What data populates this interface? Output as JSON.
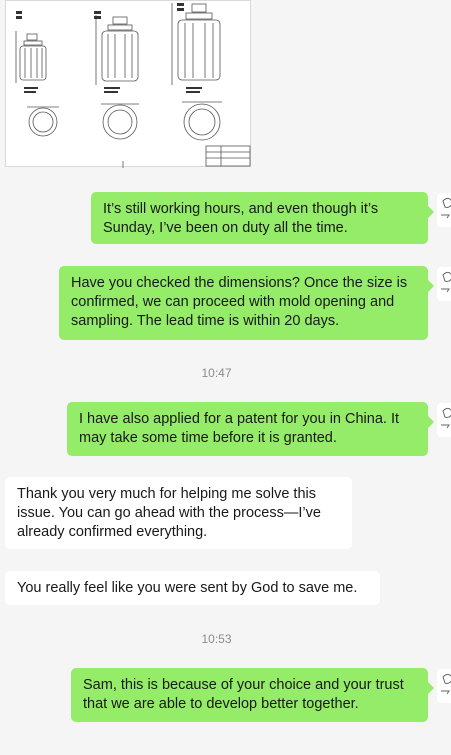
{
  "messages": [
    {
      "id": "m1",
      "side": "out",
      "text": "It’s still working hours, and even though it’s Sunday, I’ve been on duty all the time."
    },
    {
      "id": "m2",
      "side": "out",
      "text": "Have you checked the dimensions? Once the size is confirmed, we can proceed with mold opening and sampling. The lead time is within 20 days."
    },
    {
      "id": "m3",
      "side": "out",
      "text": "I have also applied for a patent for you in China. It may take some time before it is granted."
    },
    {
      "id": "m4",
      "side": "in",
      "text": "Thank you very much for helping me solve this issue. You can go ahead with the process—I’ve already confirmed everything."
    },
    {
      "id": "m5",
      "side": "in",
      "text": "You really feel like you were sent by God to save me."
    },
    {
      "id": "m6",
      "side": "out",
      "text": "Sam, this is because of your choice and your trust that we are able to develop better together."
    }
  ],
  "timestamps": [
    "10:47",
    "10:53"
  ],
  "colors": {
    "outgoing_bubble": "#95ec69",
    "incoming_bubble": "#ffffff",
    "background": "#f5f5f5",
    "timestamp": "#8c8c8c"
  },
  "icons": {
    "attachment": "technical-drawing-image",
    "avatar": "user-avatar-icon"
  }
}
